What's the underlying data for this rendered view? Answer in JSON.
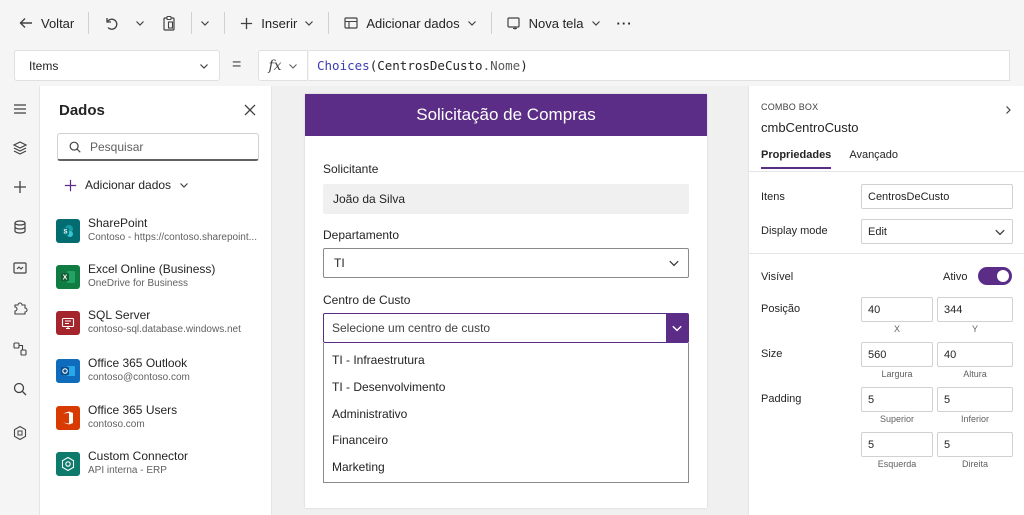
{
  "toolbar": {
    "back_label": "Voltar",
    "insert_label": "Inserir",
    "add_data_label": "Adicionar dados",
    "new_screen_label": "Nova tela",
    "more_label": "···"
  },
  "formula_bar": {
    "property": "Items",
    "equals": "=",
    "fx": "fx",
    "formula_fn": "Choices",
    "formula_open": "(",
    "formula_id": "CentrosDeCusto",
    "formula_prop": ".Nome",
    "formula_close": ")"
  },
  "rail": {
    "icons": [
      "hamburger-icon",
      "layers-icon",
      "plus-icon",
      "database-icon",
      "media-icon",
      "puzzle-icon",
      "flow-icon",
      "search-icon",
      "component-icon"
    ]
  },
  "data_panel": {
    "title": "Dados",
    "search_placeholder": "Pesquisar",
    "add_data_label": "Adicionar dados",
    "connections": [
      {
        "name": "SharePoint",
        "sub": "Contoso - https://contoso.sharepoint...",
        "icon": "sharepoint-icon",
        "color": "#036c70"
      },
      {
        "name": "Excel Online (Business)",
        "sub": "OneDrive for Business",
        "icon": "excel-icon",
        "color": "#107c41"
      },
      {
        "name": "SQL Server",
        "sub": "contoso-sql.database.windows.net",
        "icon": "sql-server-icon",
        "color": "#a4262c"
      },
      {
        "name": "Office 365 Outlook",
        "sub": "contoso@contoso.com",
        "icon": "outlook-icon",
        "color": "#0f6cbd"
      },
      {
        "name": "Office 365 Users",
        "sub": "contoso.com",
        "icon": "office-icon",
        "color": "#d83b01"
      },
      {
        "name": "Custom Connector",
        "sub": "API interna - ERP",
        "icon": "custom-connector-icon",
        "color": "#0e7a6b"
      }
    ]
  },
  "form": {
    "title": "Solicitação de Compras",
    "requester_label": "Solicitante",
    "requester_value": "João da Silva",
    "department_label": "Departamento",
    "department_value": "TI",
    "cost_center_label": "Centro de Custo",
    "cost_center_placeholder": "Selecione um centro de custo",
    "options": [
      "TI - Infraestrutura",
      "TI - Desenvolvimento",
      "Administrativo",
      "Financeiro",
      "Marketing"
    ]
  },
  "properties": {
    "control_type": "COMBO BOX",
    "control_name": "cmbCentroCusto",
    "tabs": [
      "Propriedades",
      "Avançado"
    ],
    "items_label": "Itens",
    "items_value": "CentrosDeCusto",
    "display_mode_label": "Display mode",
    "display_mode_value": "Edit",
    "visible_label": "Visível",
    "visible_state": "Ativo",
    "position_label": "Posição",
    "x_value": "40",
    "y_value": "344",
    "x_caption": "X",
    "y_caption": "Y",
    "size_label": "Size",
    "width_value": "560",
    "height_value": "40",
    "width_caption": "Largura",
    "height_caption": "Altura",
    "padding_label": "Padding",
    "pad_top": "5",
    "pad_bottom": "5",
    "pad_left": "5",
    "pad_right": "5",
    "pad_top_caption": "Superior",
    "pad_bottom_caption": "Inferior",
    "pad_left_caption": "Esquerda",
    "pad_right_caption": "Direita"
  },
  "colors": {
    "accent": "#5b2d86",
    "formula_fn": "#3b3bb3"
  }
}
